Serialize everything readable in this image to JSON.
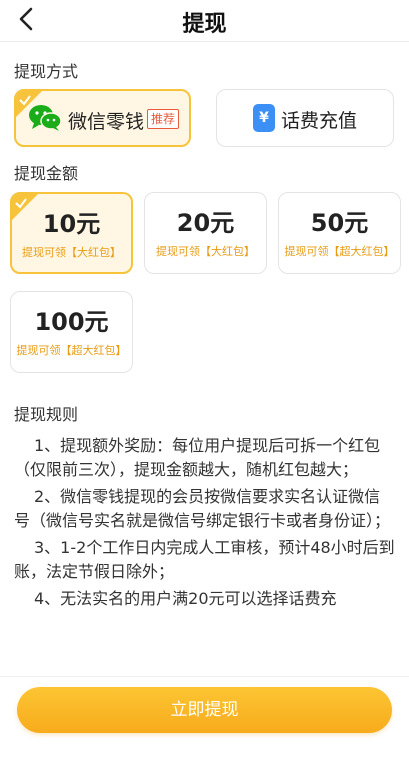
{
  "header": {
    "title": "提现"
  },
  "method_section": {
    "label": "提现方式"
  },
  "methods": [
    {
      "label": "微信零钱",
      "badge": "推荐",
      "selected": true,
      "icon": "wechat-icon"
    },
    {
      "label": "话费充值",
      "icon_glyph": "¥",
      "selected": false,
      "icon": "phone-yen-icon"
    }
  ],
  "amount_section": {
    "label": "提现金额"
  },
  "amounts": [
    {
      "value": "10元",
      "note": "提现可领【大红包】",
      "selected": true
    },
    {
      "value": "20元",
      "note": "提现可领【大红包】",
      "selected": false
    },
    {
      "value": "50元",
      "note": "提现可领【超大红包】",
      "selected": false
    },
    {
      "value": "100元",
      "note": "提现可领【超大红包】",
      "selected": false
    }
  ],
  "rules": {
    "title": "提现规则",
    "items": [
      "1、提现额外奖励：每位用户提现后可拆一个红包（仅限前三次），提现金额越大，随机红包越大；",
      "2、微信零钱提现的会员按微信要求实名认证微信号（微信号实名就是微信号绑定银行卡或者身份证）；",
      "3、1-2个工作日内完成人工审核，预计48小时后到账，法定节假日除外；",
      "4、无法实名的用户满20元可以选择话费充"
    ]
  },
  "submit": {
    "label": "立即提现"
  },
  "colors": {
    "accent": "#f7b324",
    "selected_bg": "#fff7e3",
    "badge": "#e85a3c",
    "note": "#e89c14",
    "wechat": "#1aad19",
    "phone": "#3b8ff5"
  }
}
